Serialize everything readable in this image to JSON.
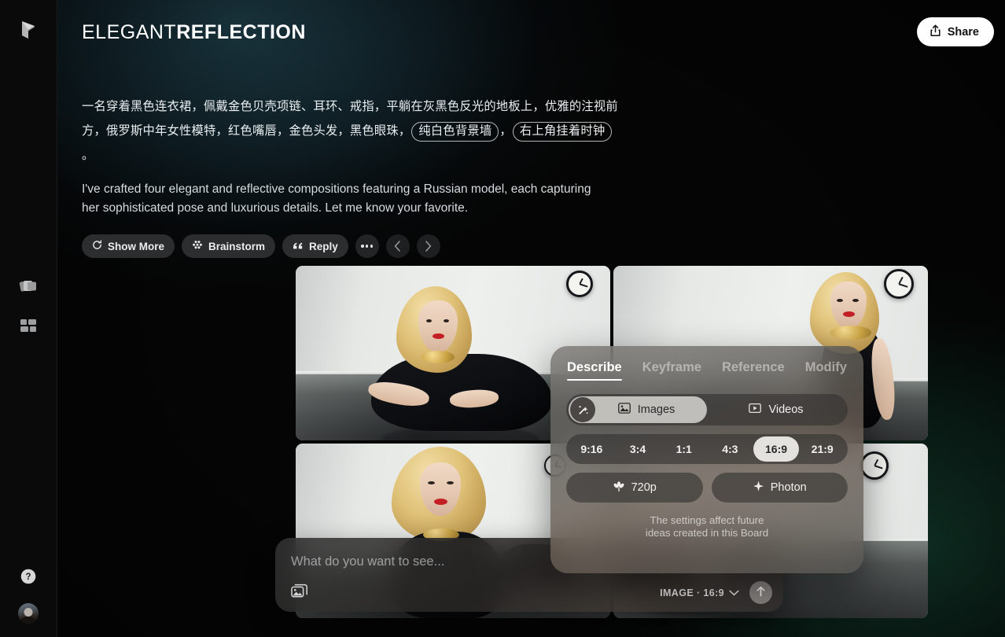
{
  "sidebar": {
    "logo_icon": "flag-logo-icon",
    "items": [
      {
        "name": "cards-icon",
        "label": "Boards"
      },
      {
        "name": "grid-icon",
        "label": "Gallery"
      }
    ],
    "help_icon": "question-mark-icon",
    "avatar": "user-avatar"
  },
  "header": {
    "title_light": "ELEGANT",
    "title_bold": "REFLECTION",
    "share_label": "Share",
    "share_icon": "share-upload-icon"
  },
  "conversation": {
    "prompt": {
      "part1": "一名穿着黑色连衣裙，佩戴金色贝壳项链、耳环、戒指，平躺在灰黑色反光的地板上，优雅的注视前方，俄罗斯中年女性模特，红色嘴唇，金色头发，黑色眼珠，",
      "chip1": "纯白色背景墙",
      "part2": "，",
      "chip2": "右上角挂着时钟",
      "part3": "。"
    },
    "assistant_reply": "I've crafted four elegant and reflective compositions featuring a Russian model, each capturing her sophisticated pose and luxurious details. Let me know your favorite.",
    "actions": [
      {
        "name": "show-more-button",
        "label": "Show More",
        "icon": "refresh-icon"
      },
      {
        "name": "brainstorm-button",
        "label": "Brainstorm",
        "icon": "dots-cluster-icon"
      },
      {
        "name": "reply-button",
        "label": "Reply",
        "icon": "quote-icon"
      }
    ],
    "more_icon": "ellipsis-icon",
    "prev_icon": "chevron-left-icon",
    "next_icon": "chevron-right-icon"
  },
  "gallery": {
    "images": [
      {
        "alt": "Blonde model in black dress lying on reflective floor, white wall, wall clock top right"
      },
      {
        "alt": "Blonde model seated in black dress with gold shell necklace, white wall, wall clock top right"
      },
      {
        "alt": "Blonde model leaning forward in black dress, white wall, wall clock"
      },
      {
        "alt": "Blonde model reclining on reflective floor, white wall, wall clock top right"
      }
    ]
  },
  "settings_popover": {
    "tabs": [
      {
        "label": "Describe",
        "active": true
      },
      {
        "label": "Keyframe",
        "active": false
      },
      {
        "label": "Reference",
        "active": false
      },
      {
        "label": "Modify",
        "active": false
      }
    ],
    "media_toggle": {
      "wand_icon": "magic-wand-icon",
      "options": [
        {
          "label": "Images",
          "icon": "image-icon",
          "selected": true
        },
        {
          "label": "Videos",
          "icon": "video-play-icon",
          "selected": false
        }
      ]
    },
    "aspect_ratios": [
      {
        "label": "9:16",
        "selected": false
      },
      {
        "label": "3:4",
        "selected": false
      },
      {
        "label": "1:1",
        "selected": false
      },
      {
        "label": "4:3",
        "selected": false
      },
      {
        "label": "16:9",
        "selected": true
      },
      {
        "label": "21:9",
        "selected": false
      }
    ],
    "options": [
      {
        "label": "720p",
        "icon": "flower-resolution-icon",
        "name": "resolution-button"
      },
      {
        "label": "Photon",
        "icon": "sparkle-icon",
        "name": "model-button"
      }
    ],
    "note_line1": "The settings affect future",
    "note_line2": "ideas created in this Board"
  },
  "composer": {
    "placeholder": "What do you want to see...",
    "value": "",
    "attach_icon": "image-stack-icon",
    "format_label": "IMAGE · 16:9",
    "chevron_icon": "chevron-down-icon",
    "send_icon": "arrow-up-icon"
  },
  "colors": {
    "accent_teal": "#20424e",
    "accent_green": "#144030",
    "share_bg": "#ffffff",
    "popover_selected": "#e4e2de",
    "pill_bg": "#2b2d2e"
  }
}
